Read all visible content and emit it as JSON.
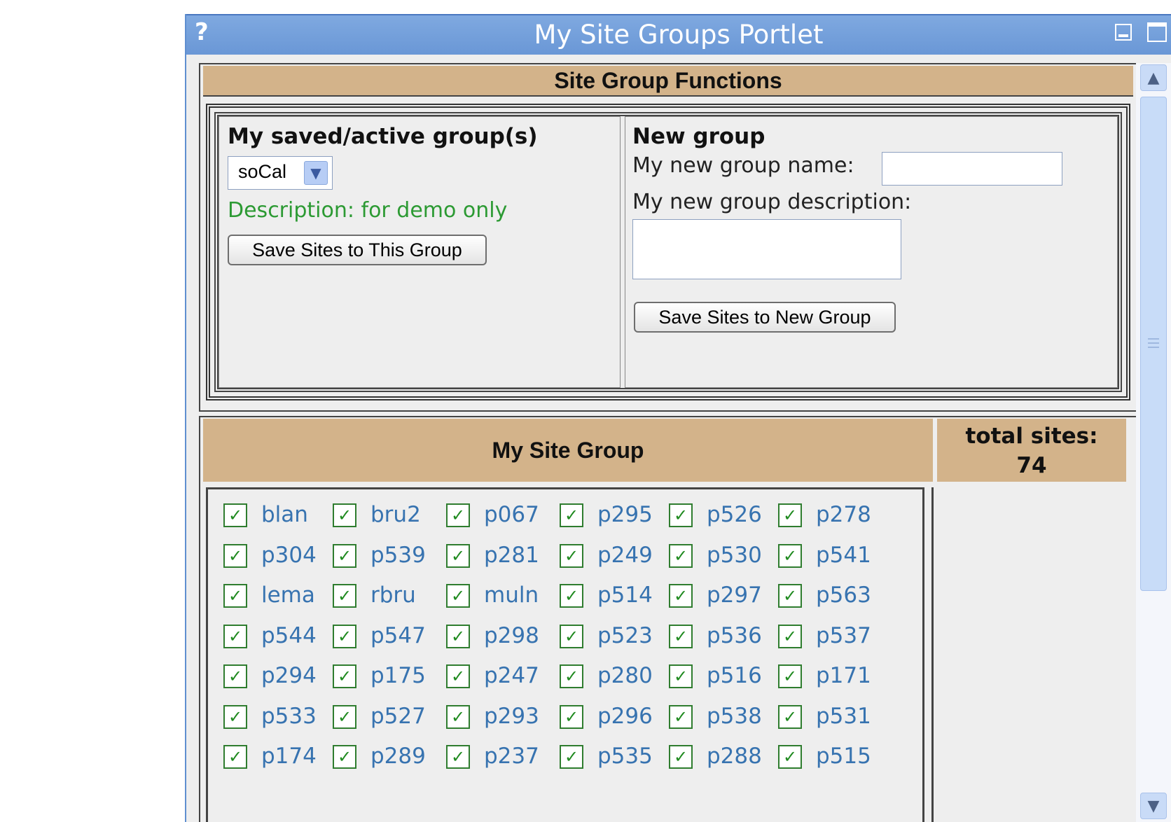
{
  "portlet": {
    "help_label": "?",
    "title": "My Site Groups Portlet"
  },
  "functions": {
    "header": "Site Group Functions",
    "saved": {
      "title": "My saved/active group(s)",
      "selected_group": "soCal",
      "description": "Description: for demo only",
      "save_button": "Save Sites to This Group"
    },
    "new_group": {
      "title": "New group",
      "name_label": "My new group name:",
      "name_value": "",
      "description_label": "My new group description:",
      "description_value": "",
      "save_button": "Save Sites to New Group"
    }
  },
  "site_group": {
    "header": "My Site Group",
    "total_label": "total sites:",
    "total_value": "74",
    "rows": [
      [
        "blan",
        "bru2",
        "p067",
        "p295",
        "p526",
        "p278"
      ],
      [
        "p304",
        "p539",
        "p281",
        "p249",
        "p530",
        "p541"
      ],
      [
        "lema",
        "rbru",
        "muln",
        "p514",
        "p297",
        "p563"
      ],
      [
        "p544",
        "p547",
        "p298",
        "p523",
        "p536",
        "p537"
      ],
      [
        "p294",
        "p175",
        "p247",
        "p280",
        "p516",
        "p171"
      ],
      [
        "p533",
        "p527",
        "p293",
        "p296",
        "p538",
        "p531"
      ],
      [
        "p174",
        "p289",
        "p237",
        "p535",
        "p288",
        "p515"
      ]
    ]
  },
  "icons": {
    "checkbox": "checked-checkbox-icon",
    "scroll_up": "chevron-up-icon",
    "scroll_down": "chevron-down-icon"
  }
}
